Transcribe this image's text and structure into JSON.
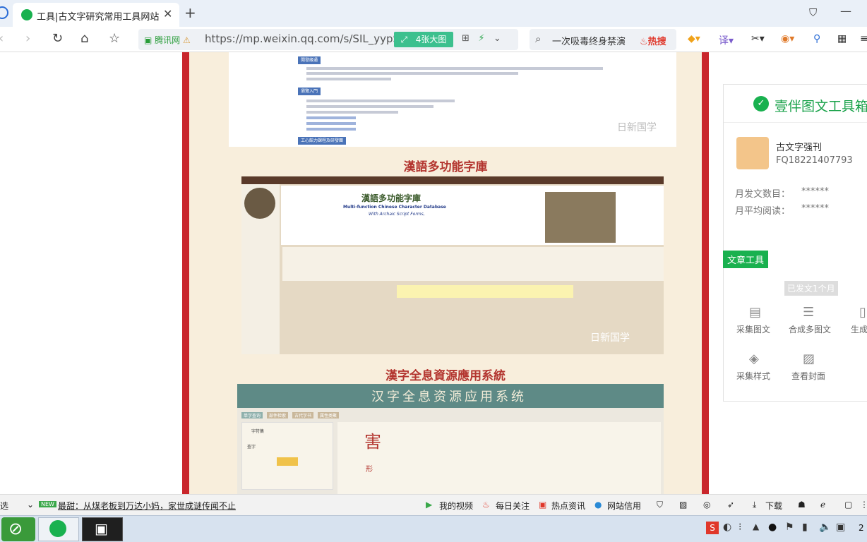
{
  "browser": {
    "tab_title": "工具|古文字研究常用工具网站",
    "url": "https://mp.weixin.qq.com/s/SIL_yypSZF",
    "cert_label": "腾讯网",
    "image_badge": "4张大图",
    "search_query": "一次吸毒终身禁演",
    "search_hot": "热搜"
  },
  "article": {
    "watermark": "日新国学",
    "section1_title": "漢語多功能字庫",
    "section2_title": "漢字全息資源應用系統",
    "shot1": {
      "bar1": "開發緣通",
      "bar2": "瀏覽入門",
      "bar3": "工心館力課程及研發團"
    },
    "shot2": {
      "title": "漢語多功能字庫",
      "subtitle_en": "Multi-function Chinese Character Database",
      "subtitle_en2": "With Archaic Script Forms,"
    },
    "shot3": {
      "banner": "汉字全息资源应用系统",
      "tabs": [
        "单字查询",
        "部件检索",
        "古代字书",
        "属性类聚"
      ],
      "field1": "字符集",
      "field2": "查字",
      "big_char": "害",
      "row_label": "形"
    }
  },
  "panel": {
    "title": "壹伴图文工具箱",
    "account_name": "古文字强刊",
    "account_id": "FQ18221407793",
    "monthly_posts_label": "月发文数目：",
    "monthly_posts_value": "******",
    "avg_reads_label": "月平均阅读：",
    "avg_reads_value": "******",
    "section_label": "文章工具",
    "published_badge": "已发文1个月",
    "tools": [
      "采集图文",
      "合成多图文",
      "生成",
      "采集样式",
      "查看封面"
    ]
  },
  "statusbar": {
    "left_trunc": "选",
    "news_badge": "NEW",
    "news": "最甜：从煤老板到万达小妈，家世成谜传闻不止",
    "items": [
      "我的视频",
      "每日关注",
      "热点资讯",
      "网站信用",
      "下载"
    ]
  },
  "taskbar": {
    "time_trunc": "2"
  }
}
